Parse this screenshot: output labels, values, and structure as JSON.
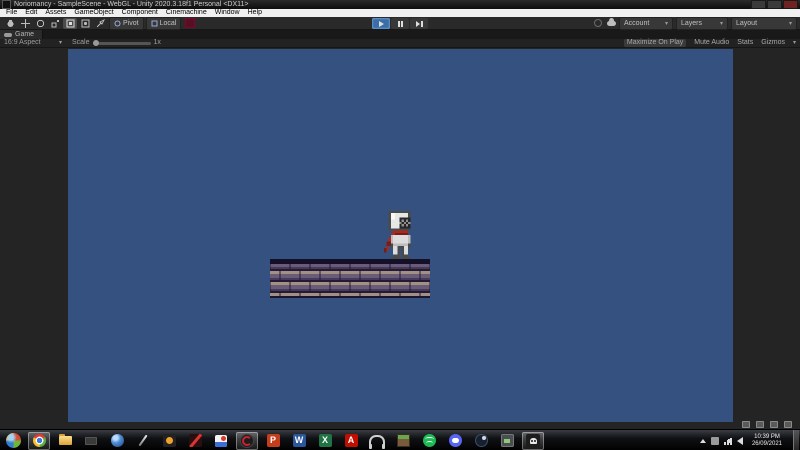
{
  "window": {
    "title": "Noriomancy - SampleScene - WebGL - Unity 2020.3.18f1 Personal <DX11>"
  },
  "menu_bar": {
    "items": [
      "File",
      "Edit",
      "Assets",
      "GameObject",
      "Component",
      "Cinemachine",
      "Window",
      "Help"
    ]
  },
  "toolbar": {
    "tool_icons": [
      "hand-tool",
      "move-tool",
      "rotate-tool",
      "scale-tool",
      "rect-tool",
      "transform-tool",
      "custom-tool"
    ],
    "pivot": "Pivot",
    "local": "Local",
    "play_state": "playing",
    "account": "Account",
    "layers": "Layers",
    "layout": "Layout"
  },
  "game_view": {
    "tab": "Game",
    "aspect": "16:9 Aspect",
    "scale_label": "Scale",
    "scale_value": "1x",
    "maximize_on_play": "Maximize On Play",
    "mute_audio": "Mute Audio",
    "stats": "Stats",
    "gizmos": "Gizmos"
  },
  "scene": {
    "background_color": "#35517F",
    "entities": [
      "knight-character",
      "brick-platform"
    ]
  },
  "taskbar": {
    "icons": [
      "start",
      "chrome",
      "file-explorer",
      "camera-tool",
      "blue-sphere-app",
      "pen-tool",
      "bell-app",
      "red-tool-app",
      "paint-app",
      "dark-circle-app",
      "powerpoint",
      "word",
      "excel",
      "acrobat",
      "headset-app",
      "minecraft",
      "spotify",
      "discord",
      "steam",
      "gamepad-app",
      "skull-app"
    ],
    "office_letters": {
      "powerpoint": "P",
      "word": "W",
      "excel": "X",
      "acrobat": "A"
    },
    "tray": {
      "time": "10:39 PM",
      "date": "26/09/2021"
    }
  }
}
